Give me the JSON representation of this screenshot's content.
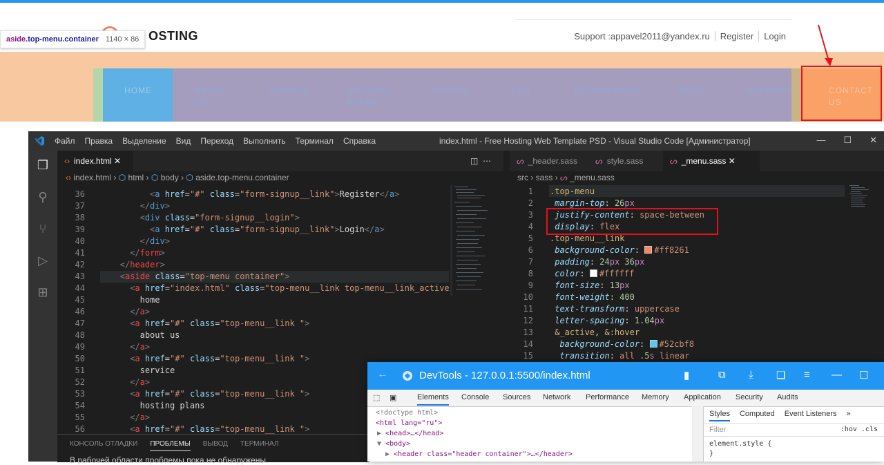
{
  "site": {
    "logo_text": "OSTING",
    "hint_selector_tag": "aside",
    "hint_selector_class": ".top-menu.container",
    "hint_size": "1140 × 86",
    "support": "Support :appavel2011@yandex.ru",
    "register": "Register",
    "login": "Login",
    "menu": [
      {
        "label": "HOME",
        "line2": ""
      },
      {
        "label": "ABOUT",
        "line2": "US"
      },
      {
        "label": "SERVICE",
        "line2": ""
      },
      {
        "label": "HOSTING",
        "line2": "PLANS"
      },
      {
        "label": "DOMAIN",
        "line2": ""
      },
      {
        "label": "FAQ",
        "line2": ""
      },
      {
        "label": "TESTIMONIALS",
        "line2": ""
      },
      {
        "label": "BLOG",
        "line2": ""
      },
      {
        "label": "SUPPORT",
        "line2": ""
      },
      {
        "label": "CONTACT",
        "line2": "US"
      }
    ]
  },
  "vscode": {
    "menu": [
      "Файл",
      "Правка",
      "Выделение",
      "Вид",
      "Переход",
      "Выполнить",
      "Терминал",
      "Справка"
    ],
    "window_title": "index.html - Free Hosting Web Template PSD - Visual Studio Code [Администратор]",
    "left_tab": "index.html",
    "left_breadcrumb": [
      "index.html",
      "html",
      "body",
      "aside.top-menu.container"
    ],
    "right_tabs": [
      "_header.sass",
      "style.sass",
      "_menu.sass"
    ],
    "right_breadcrumb": [
      "src",
      "sass",
      "_menu.sass"
    ],
    "left_lines": [
      {
        "n": "36",
        "html": "<span class=\"tg2\">&lt;</span><span class=\"tg\">a</span> <span class=\"at\">href</span>=<span class=\"st\">\"#\"</span> <span class=\"at\">class</span>=<span class=\"st\">\"form-signup__link\"</span><span class=\"tg2\">&gt;</span>Register<span class=\"tg2\">&lt;/</span><span class=\"tg\">a</span><span class=\"tg2\">&gt;</span>",
        "indent": 10
      },
      {
        "n": "37",
        "html": "<span class=\"tg2\">&lt;/</span><span class=\"tg\">div</span><span class=\"tg2\">&gt;</span>",
        "indent": 8
      },
      {
        "n": "38",
        "html": "<span class=\"tg2\">&lt;</span><span class=\"tg\">div</span> <span class=\"at\">class</span>=<span class=\"st\">\"form-signup__login\"</span><span class=\"tg2\">&gt;</span>",
        "indent": 8
      },
      {
        "n": "39",
        "html": "<span class=\"tg2\">&lt;</span><span class=\"tg\">a</span> <span class=\"at\">href</span>=<span class=\"st\">\"#\"</span> <span class=\"at\">class</span>=<span class=\"st\">\"form-signup__link\"</span><span class=\"tg2\">&gt;</span>Login<span class=\"tg2\">&lt;/</span><span class=\"tg\">a</span><span class=\"tg2\">&gt;</span>",
        "indent": 10
      },
      {
        "n": "40",
        "html": "<span class=\"tg2\">&lt;/</span><span class=\"tg\">div</span><span class=\"tg2\">&gt;</span>",
        "indent": 8
      },
      {
        "n": "41",
        "html": "<span class=\"tg2\">&lt;/</span><span class=\"tgr\">form</span><span class=\"tg2\">&gt;</span>",
        "indent": 6
      },
      {
        "n": "42",
        "html": "<span class=\"tg2\">&lt;/</span><span class=\"tgr\">header</span><span class=\"tg2\">&gt;</span>",
        "indent": 4
      },
      {
        "n": "43",
        "html": "<span class=\"tg2\">&lt;</span><span class=\"tgr\">aside</span> <span class=\"at\">class</span>=<span class=\"st\">\"top-menu container\"</span><span class=\"tg2\">&gt;</span>",
        "indent": 4
      },
      {
        "n": "44",
        "html": "<span class=\"tg2\">&lt;</span><span class=\"tgr\">a</span> <span class=\"at\">href</span>=<span class=\"st\">\"index.html\"</span> <span class=\"at\">class</span>=<span class=\"st\">\"top-menu__link top-menu__link_active \"</span><span class=\"tg2\">&gt;</span>",
        "indent": 6
      },
      {
        "n": "45",
        "html": "home",
        "indent": 8
      },
      {
        "n": "46",
        "html": "<span class=\"tg2\">&lt;/</span><span class=\"tgr\">a</span><span class=\"tg2\">&gt;</span>",
        "indent": 6
      },
      {
        "n": "47",
        "html": "<span class=\"tg2\">&lt;</span><span class=\"tgr\">a</span> <span class=\"at\">href</span>=<span class=\"st\">\"#\"</span> <span class=\"at\">class</span>=<span class=\"st\">\"top-menu__link \"</span><span class=\"tg2\">&gt;</span>",
        "indent": 6
      },
      {
        "n": "48",
        "html": "about us",
        "indent": 8
      },
      {
        "n": "49",
        "html": "<span class=\"tg2\">&lt;/</span><span class=\"tgr\">a</span><span class=\"tg2\">&gt;</span>",
        "indent": 6
      },
      {
        "n": "50",
        "html": "<span class=\"tg2\">&lt;</span><span class=\"tgr\">a</span> <span class=\"at\">href</span>=<span class=\"st\">\"#\"</span> <span class=\"at\">class</span>=<span class=\"st\">\"top-menu__link \"</span><span class=\"tg2\">&gt;</span>",
        "indent": 6
      },
      {
        "n": "51",
        "html": "service",
        "indent": 8
      },
      {
        "n": "52",
        "html": "<span class=\"tg2\">&lt;/</span><span class=\"tgr\">a</span><span class=\"tg2\">&gt;</span>",
        "indent": 6
      },
      {
        "n": "53",
        "html": "<span class=\"tg2\">&lt;</span><span class=\"tgr\">a</span> <span class=\"at\">href</span>=<span class=\"st\">\"#\"</span> <span class=\"at\">class</span>=<span class=\"st\">\"top-menu__link \"</span><span class=\"tg2\">&gt;</span>",
        "indent": 6
      },
      {
        "n": "54",
        "html": "hosting plans",
        "indent": 8
      },
      {
        "n": "55",
        "html": "<span class=\"tg2\">&lt;/</span><span class=\"tgr\">a</span><span class=\"tg2\">&gt;</span>",
        "indent": 6
      },
      {
        "n": "56",
        "html": "<span class=\"tg2\">&lt;</span><span class=\"tgr\">a</span> <span class=\"at\">href</span>=<span class=\"st\">\"#\"</span> <span class=\"at\">class</span>=<span class=\"st\">\"top-menu__link \"</span><span class=\"tg2\">&gt;</span>",
        "indent": 6
      }
    ],
    "right_lines": [
      {
        "n": "1",
        "html": "<span class=\"sel-y\">.top-menu</span>"
      },
      {
        "n": "2",
        "html": " <span class=\"prop\">margin-top</span><span class=\"op\">: </span><span class=\"num\">26</span><span class=\"px\">px</span>"
      },
      {
        "n": "3",
        "html": " <span class=\"prop\">justify-content</span><span class=\"op\">: </span><span class=\"kw\">space-between</span>"
      },
      {
        "n": "4",
        "html": " <span class=\"prop\">display</span><span class=\"op\">: </span><span class=\"kw\">flex</span>"
      },
      {
        "n": "5",
        "html": "<span class=\"sel-y\">.top-menu__link</span>"
      },
      {
        "n": "6",
        "html": " <span class=\"prop\">background-color</span><span class=\"op\">: </span><span class=\"sw\" style=\"background:#ff8261\"></span><span class=\"kw\">#ff8261</span>"
      },
      {
        "n": "7",
        "html": " <span class=\"prop\">padding</span><span class=\"op\">: </span><span class=\"num\">24</span><span class=\"px\">px</span> <span class=\"num\">36</span><span class=\"px\">px</span>"
      },
      {
        "n": "8",
        "html": " <span class=\"prop\">color</span><span class=\"op\">: </span><span class=\"sw\" style=\"background:#ffffff\"></span><span class=\"kw\">#ffffff</span>"
      },
      {
        "n": "9",
        "html": " <span class=\"prop\">font-size</span><span class=\"op\">: </span><span class=\"num\">13</span><span class=\"px\">px</span>"
      },
      {
        "n": "10",
        "html": " <span class=\"prop\">font-weight</span><span class=\"op\">: </span><span class=\"num\">400</span>"
      },
      {
        "n": "11",
        "html": " <span class=\"prop\">text-transform</span><span class=\"op\">: </span><span class=\"kw\">uppercase</span>"
      },
      {
        "n": "12",
        "html": " <span class=\"prop\">letter-spacing</span><span class=\"op\">: </span><span class=\"num\">1.04</span><span class=\"px\">px</span>"
      },
      {
        "n": "13",
        "html": " <span class=\"sel-y\">&amp;_active</span><span class=\"op\">, </span><span class=\"sel-y\">&amp;:hover</span>"
      },
      {
        "n": "14",
        "html": "  <span class=\"prop\">background-color</span><span class=\"op\">: </span><span class=\"sw\" style=\"background:#52cbf8\"></span><span class=\"kw\">#52cbf8</span>"
      },
      {
        "n": "15",
        "html": "  <span class=\"prop\">transition</span><span class=\"op\">: </span><span class=\"kw\">all</span> <span class=\"num\">.5</span><span class=\"px\">s</span> <span class=\"kw\">linear</span>"
      }
    ],
    "panel_tabs": [
      "КОНСОЛЬ ОТЛАДКИ",
      "ПРОБЛЕМЫ",
      "ВЫВОД",
      "ТЕРМИНАЛ"
    ],
    "panel_message": "В рабочей области проблемы пока не обнаружены."
  },
  "devtools": {
    "title": "DevTools - 127.0.0.1:5500/index.html",
    "tabs": [
      "Elements",
      "Console",
      "Sources",
      "Network",
      "Performance",
      "Memory",
      "Application",
      "Security",
      "Audits"
    ],
    "dom": [
      "<!doctype html>",
      "<html lang=\"ru\">",
      "<head>…</head>",
      "<body>",
      "<header class=\"header container\">…</header>"
    ],
    "style_tabs": [
      "Styles",
      "Computed",
      "Event Listeners"
    ],
    "filter_placeholder": "Filter",
    "hov": ":hov .cls",
    "element_style": "element.style {",
    "element_style_close": "}"
  }
}
